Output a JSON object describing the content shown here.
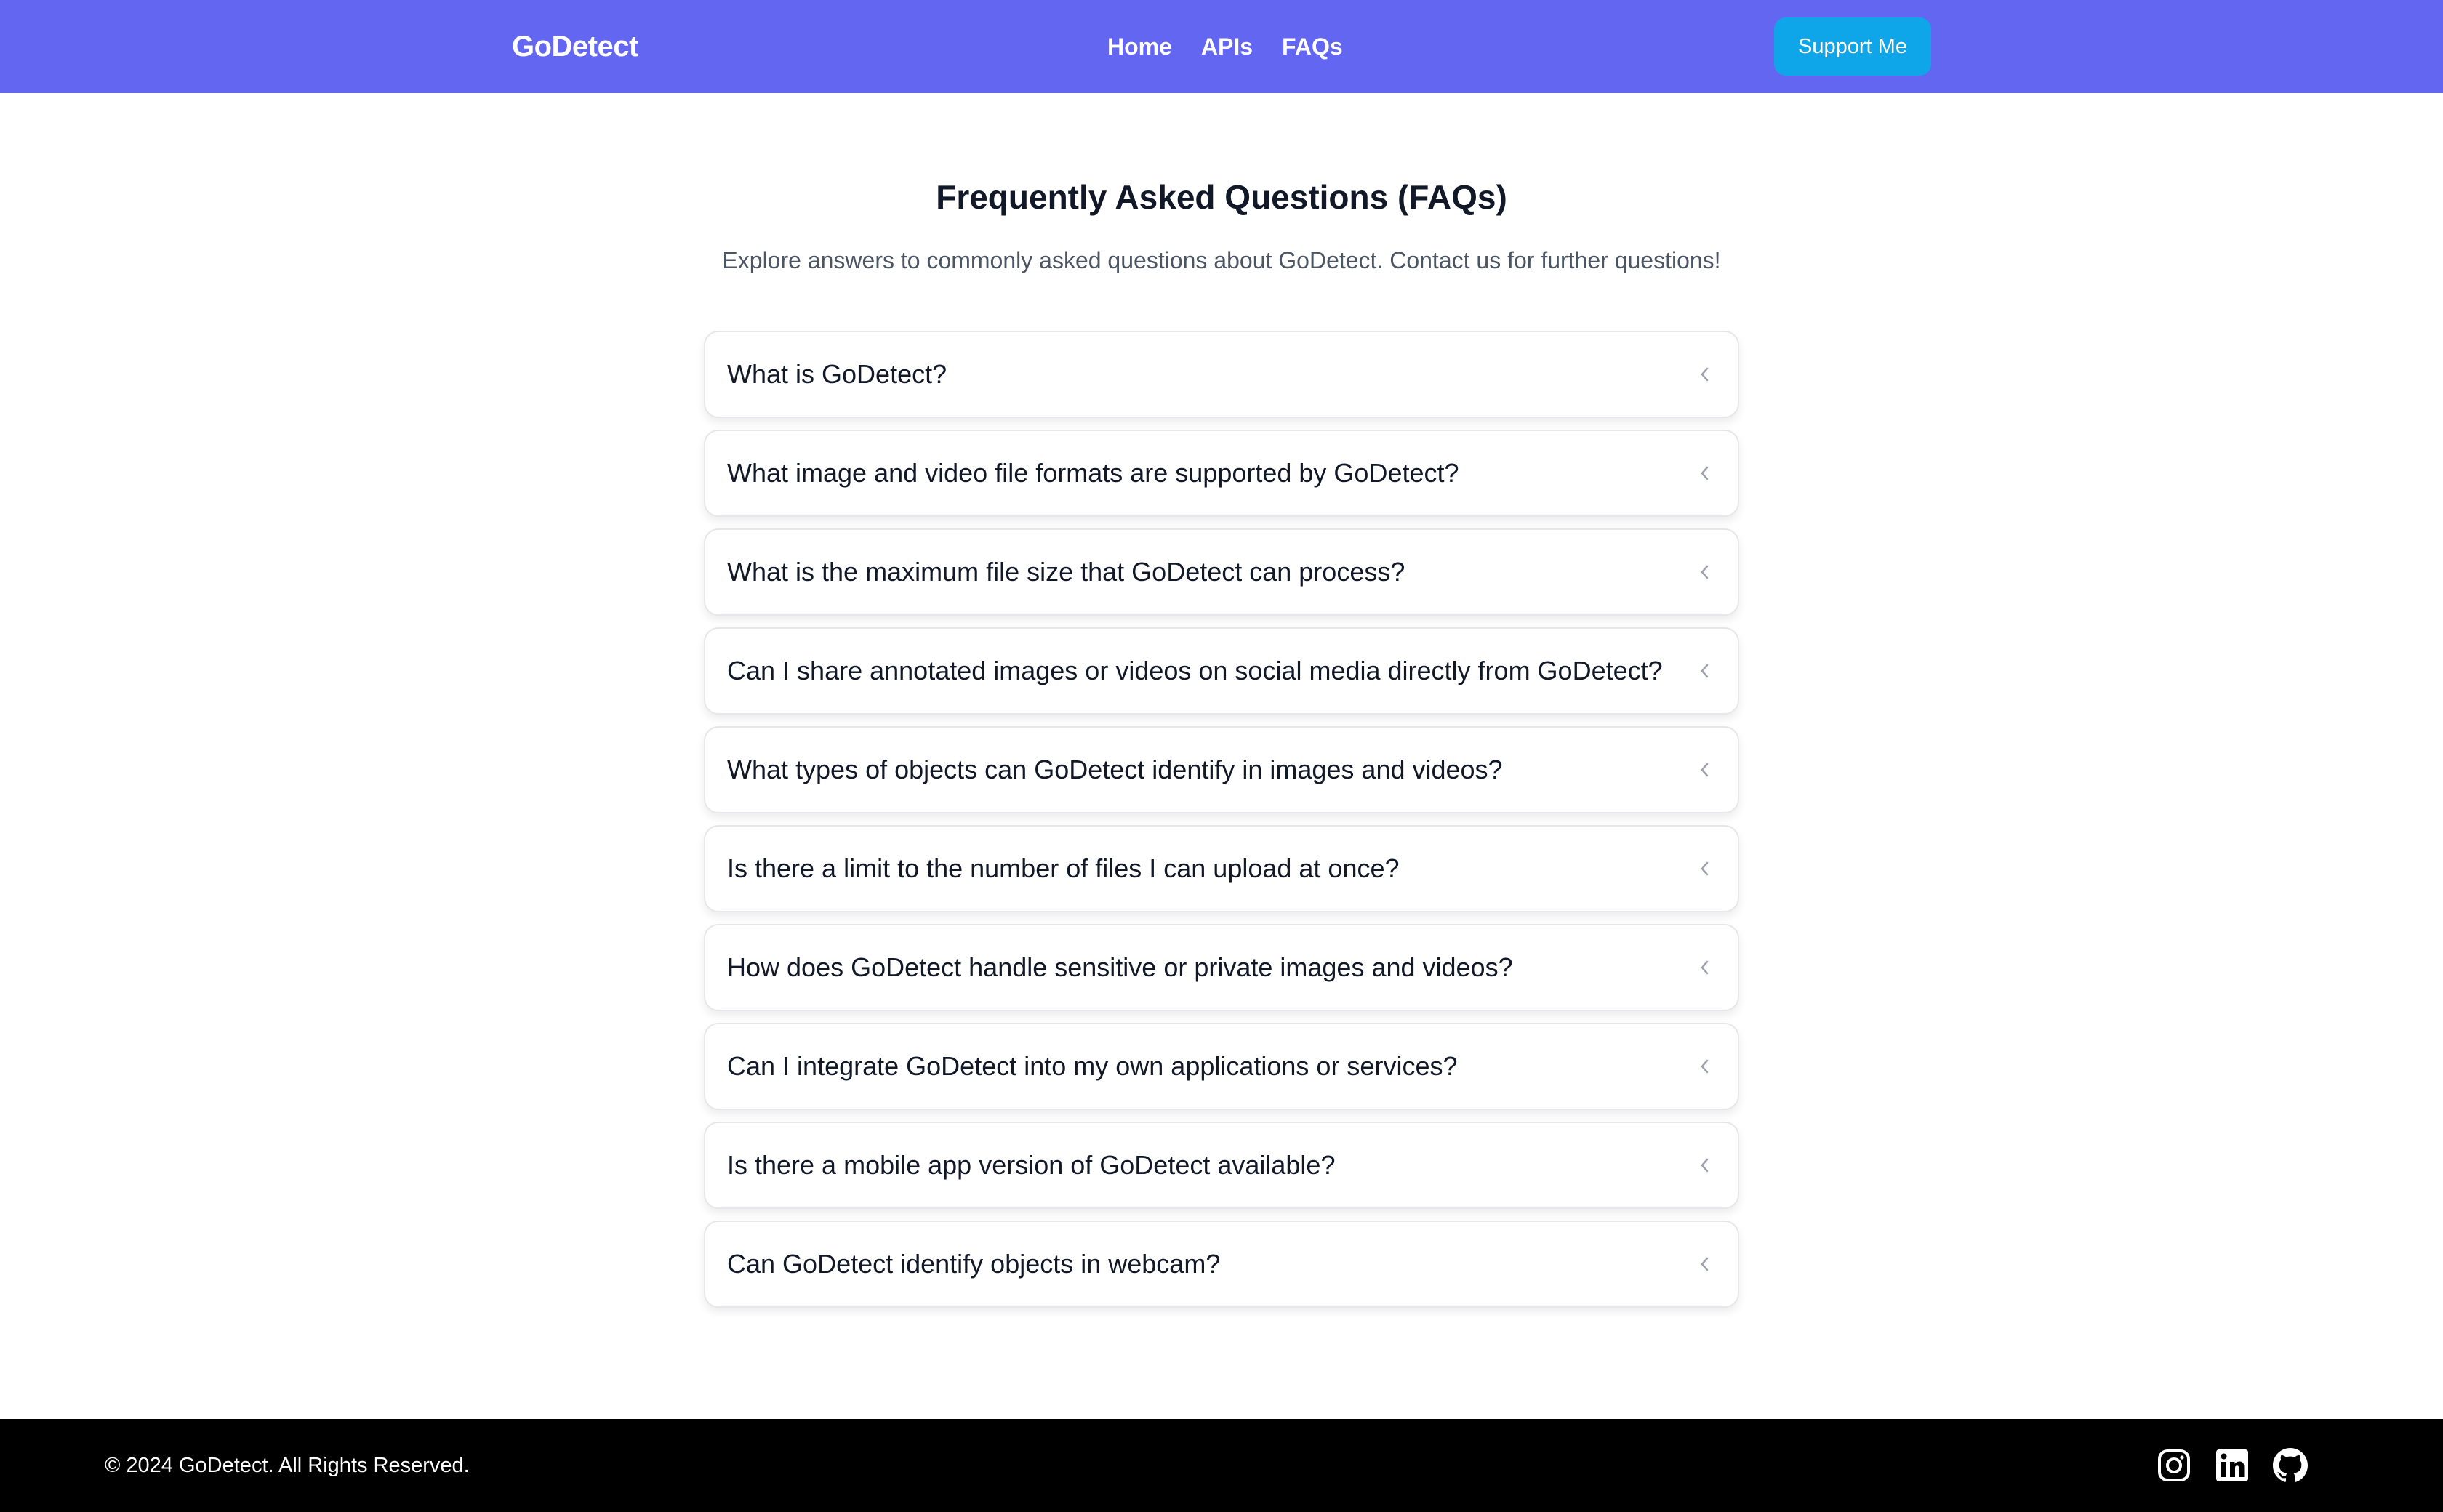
{
  "header": {
    "brand": "GoDetect",
    "nav": [
      {
        "label": "Home"
      },
      {
        "label": "APIs"
      },
      {
        "label": "FAQs"
      }
    ],
    "support_label": "Support Me"
  },
  "main": {
    "title": "Frequently Asked Questions (FAQs)",
    "subtitle": "Explore answers to commonly asked questions about GoDetect. Contact us for further questions!",
    "faqs": [
      {
        "question": "What is GoDetect?",
        "expanded": false
      },
      {
        "question": "What image and video file formats are supported by GoDetect?",
        "expanded": false
      },
      {
        "question": "What is the maximum file size that GoDetect can process?",
        "expanded": false
      },
      {
        "question": "Can I share annotated images or videos on social media directly from GoDetect?",
        "expanded": false
      },
      {
        "question": "What types of objects can GoDetect identify in images and videos?",
        "expanded": false
      },
      {
        "question": "Is there a limit to the number of files I can upload at once?",
        "expanded": false
      },
      {
        "question": "How does GoDetect handle sensitive or private images and videos?",
        "expanded": false
      },
      {
        "question": "Can I integrate GoDetect into my own applications or services?",
        "expanded": false
      },
      {
        "question": "Is there a mobile app version of GoDetect available?",
        "expanded": false
      },
      {
        "question": "Can GoDetect identify objects in webcam?",
        "expanded": false
      }
    ]
  },
  "footer": {
    "copyright": "© 2024 GoDetect. All Rights Reserved.",
    "socials": [
      {
        "icon": "instagram-icon"
      },
      {
        "icon": "linkedin-icon"
      },
      {
        "icon": "github-icon"
      }
    ]
  },
  "colors": {
    "navbar": "#6366f1",
    "support_button": "#0ea5e9",
    "footer": "#000000"
  }
}
